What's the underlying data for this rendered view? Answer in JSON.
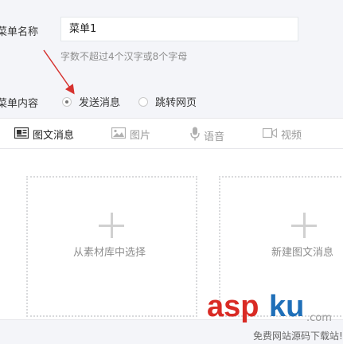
{
  "menu_name": {
    "label": "菜单名称",
    "value": "菜单1",
    "hint": "字数不超过4个汉字或8个字母"
  },
  "menu_content": {
    "label": "菜单内容",
    "options": [
      {
        "label": "发送消息",
        "checked": true
      },
      {
        "label": "跳转网页",
        "checked": false
      }
    ]
  },
  "tabs": [
    {
      "label": "图文消息",
      "icon": "news-icon",
      "active": true
    },
    {
      "label": "图片",
      "icon": "image-icon",
      "active": false
    },
    {
      "label": "语音",
      "icon": "microphone-icon",
      "active": false
    },
    {
      "label": "视频",
      "icon": "video-icon",
      "active": false
    }
  ],
  "actions": {
    "from_library": "从素材库中选择",
    "new_news": "新建图文消息"
  },
  "watermark": {
    "brand_a": "asp",
    "brand_b": "ku",
    "suffix": ".com",
    "tagline": "免费网站源码下载站!"
  },
  "colors": {
    "arrow": "#d6322f",
    "watermark_red": "#d92b25",
    "watermark_blue": "#1f6fb8"
  }
}
